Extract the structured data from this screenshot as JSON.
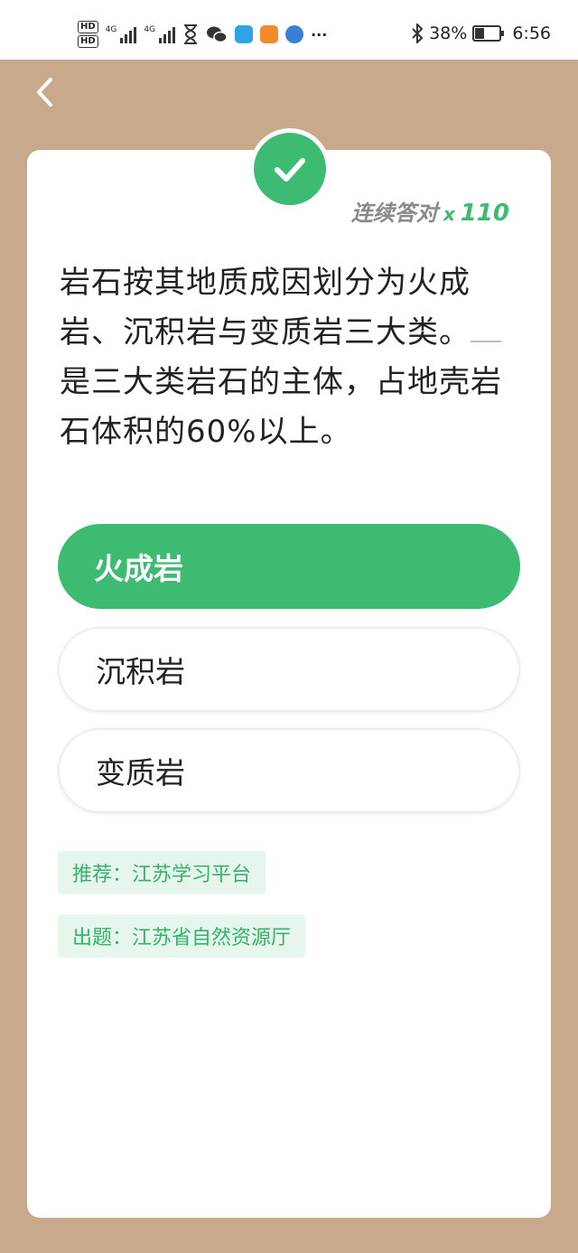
{
  "status_bar": {
    "hd1": "HD",
    "hd2": "HD",
    "net1": "4G",
    "net2": "4G",
    "more": "···",
    "battery_percent": "38%",
    "battery_level": 0.38,
    "time": "6:56",
    "icons": [
      "hourglass-icon",
      "wechat-icon",
      "lightbulb-app-icon",
      "play-app-icon",
      "globe-app-icon"
    ]
  },
  "card": {
    "streak_label": "连续答对",
    "streak_x": "x",
    "streak_count": "110",
    "question_part1": "岩石按其地质成因划分为火成岩、沉积岩与变质岩三大类。",
    "question_part2": "是三大类岩石的主体，占地壳岩石体积的60%以上。",
    "options": [
      {
        "label": "火成岩",
        "state": "correct"
      },
      {
        "label": "沉积岩",
        "state": "normal"
      },
      {
        "label": "变质岩",
        "state": "normal"
      }
    ],
    "recommend": "推荐：江苏学习平台",
    "source": "出题：江苏省自然资源厅"
  },
  "colors": {
    "accent": "#3dbb72",
    "background": "#c9a98b",
    "tag_bg": "#e6f6ec"
  }
}
